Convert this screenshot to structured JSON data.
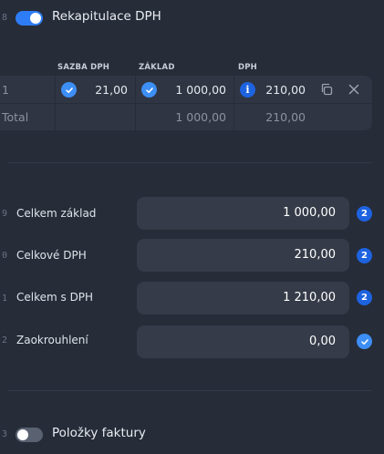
{
  "section_vat": {
    "line_number": "8",
    "toggle_on": true,
    "title": "Rekapitulace DPH"
  },
  "vat_table": {
    "headers": {
      "rate": "SAZBA DPH",
      "base": "ZÁKLAD",
      "vat": "DPH"
    },
    "rows": [
      {
        "index": "1",
        "rate": "21,00",
        "base": "1 000,00",
        "vat": "210,00"
      }
    ],
    "total": {
      "label": "Total",
      "base": "1 000,00",
      "vat": "210,00"
    }
  },
  "summary": [
    {
      "line_number": "9",
      "label": "Celkem základ",
      "value": "1 000,00",
      "badge": "2"
    },
    {
      "line_number": "0",
      "label": "Celkové DPH",
      "value": "210,00",
      "badge": "2"
    },
    {
      "line_number": "1",
      "label": "Celkem s DPH",
      "value": "1 210,00",
      "badge": "2"
    },
    {
      "line_number": "2",
      "label": "Zaokrouhlení",
      "value": "0,00",
      "badge": "check"
    }
  ],
  "section_items": {
    "line_number": "3",
    "toggle_on": false,
    "title": "Položky faktury"
  },
  "colors": {
    "background": "#262c38",
    "accent": "#2f7df6",
    "badge_dark": "#1d63e0"
  }
}
